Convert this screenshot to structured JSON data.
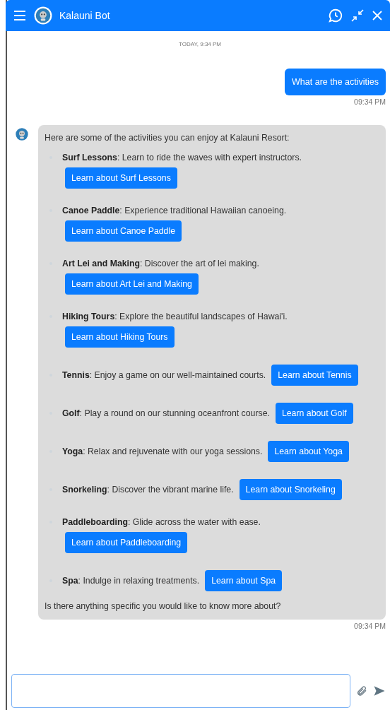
{
  "header": {
    "title": "Kalauni Bot"
  },
  "date_divider": "TODAY, 9:34 PM",
  "user_message": {
    "text": "What are the activities",
    "time": "09:34 PM"
  },
  "bot_message": {
    "intro": "Here are some of the activities you can enjoy at Kalauni Resort:",
    "items": [
      {
        "kind": "stacked",
        "text": "**Surf Lessons**: Learn to ride the waves with expert instructors.",
        "button": "Learn about Surf Lessons"
      },
      {
        "kind": "stacked",
        "text": "**Canoe Paddle**: Experience traditional Hawaiian canoeing.",
        "button": "Learn about Canoe Paddle"
      },
      {
        "kind": "stacked",
        "text": "**Art Lei and Making**: Discover the art of lei making.",
        "button": "Learn about Art Lei and Making"
      },
      {
        "kind": "stacked",
        "text": "**Hiking Tours**: Explore the beautiful landscapes of Hawai'i.",
        "button": "Learn about Hiking Tours"
      },
      {
        "kind": "inline",
        "text": "**Tennis**: Enjoy a game on our well-maintained courts.",
        "button": "Learn about Tennis"
      },
      {
        "kind": "inline",
        "text": "**Golf**: Play a round on our stunning oceanfront course.",
        "button": "Learn about Golf"
      },
      {
        "kind": "inline",
        "text": "**Yoga**: Relax and rejuvenate with our yoga sessions.",
        "button": "Learn about Yoga"
      },
      {
        "kind": "inline",
        "text": "**Snorkeling**: Discover the vibrant marine life.",
        "button": "Learn about Snorkeling"
      },
      {
        "kind": "stacked",
        "text": "**Paddleboarding**: Glide across the water with ease.",
        "button": "Learn about Paddleboarding"
      },
      {
        "kind": "inline",
        "text": "**Spa**: Indulge in relaxing treatments.",
        "button": "Learn about Spa"
      }
    ],
    "outro": "Is there anything specific you would like to know more about?",
    "time": "09:34 PM"
  }
}
